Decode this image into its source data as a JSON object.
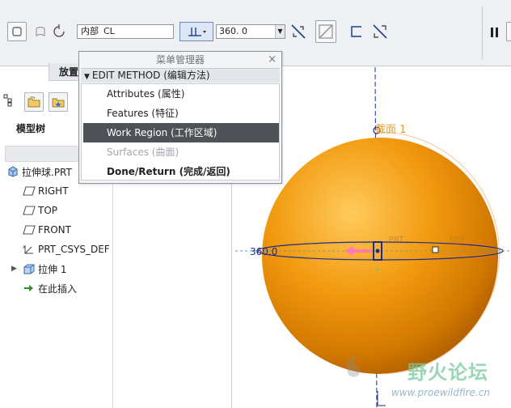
{
  "toolbar": {
    "reference_axis": {
      "label": "内部",
      "value": "CL"
    },
    "angle_value": "360. 0",
    "tab_label": "放置"
  },
  "menu_manager": {
    "title": "菜单管理器",
    "section": "EDIT METHOD (编辑方法)",
    "items": [
      {
        "label": "Attributes (属性)",
        "state": "normal"
      },
      {
        "label": "Features (特征)",
        "state": "normal"
      },
      {
        "label": "Work Region (工作区域)",
        "state": "active"
      },
      {
        "label": "Surfaces (曲面)",
        "state": "disabled"
      },
      {
        "label": "Done/Return (完成/返回)",
        "state": "bold"
      }
    ]
  },
  "model_tree": {
    "title": "模型树",
    "items": [
      {
        "label": "拉伸球.PRT",
        "icon": "part-icon"
      },
      {
        "label": "RIGHT",
        "icon": "datum-plane-icon"
      },
      {
        "label": "TOP",
        "icon": "datum-plane-icon"
      },
      {
        "label": "FRONT",
        "icon": "datum-plane-icon"
      },
      {
        "label": "PRT_CSYS_DEF",
        "icon": "csys-icon"
      },
      {
        "label": "拉伸 1",
        "icon": "extrude-icon"
      },
      {
        "label": "在此插入",
        "icon": "insert-arrow-icon"
      }
    ]
  },
  "graphics": {
    "plane_label": "截面 1",
    "dimension_label": "360.0",
    "faint_labels": [
      "PRT",
      "DEF"
    ]
  },
  "watermark": {
    "title": "野火论坛",
    "url": "www.proewildfire.cn"
  },
  "colors": {
    "sphere": "#e68a00",
    "axis_line": "#1d2d8a",
    "active_menu": "#4f5257",
    "plane_label": "#e6a032"
  }
}
